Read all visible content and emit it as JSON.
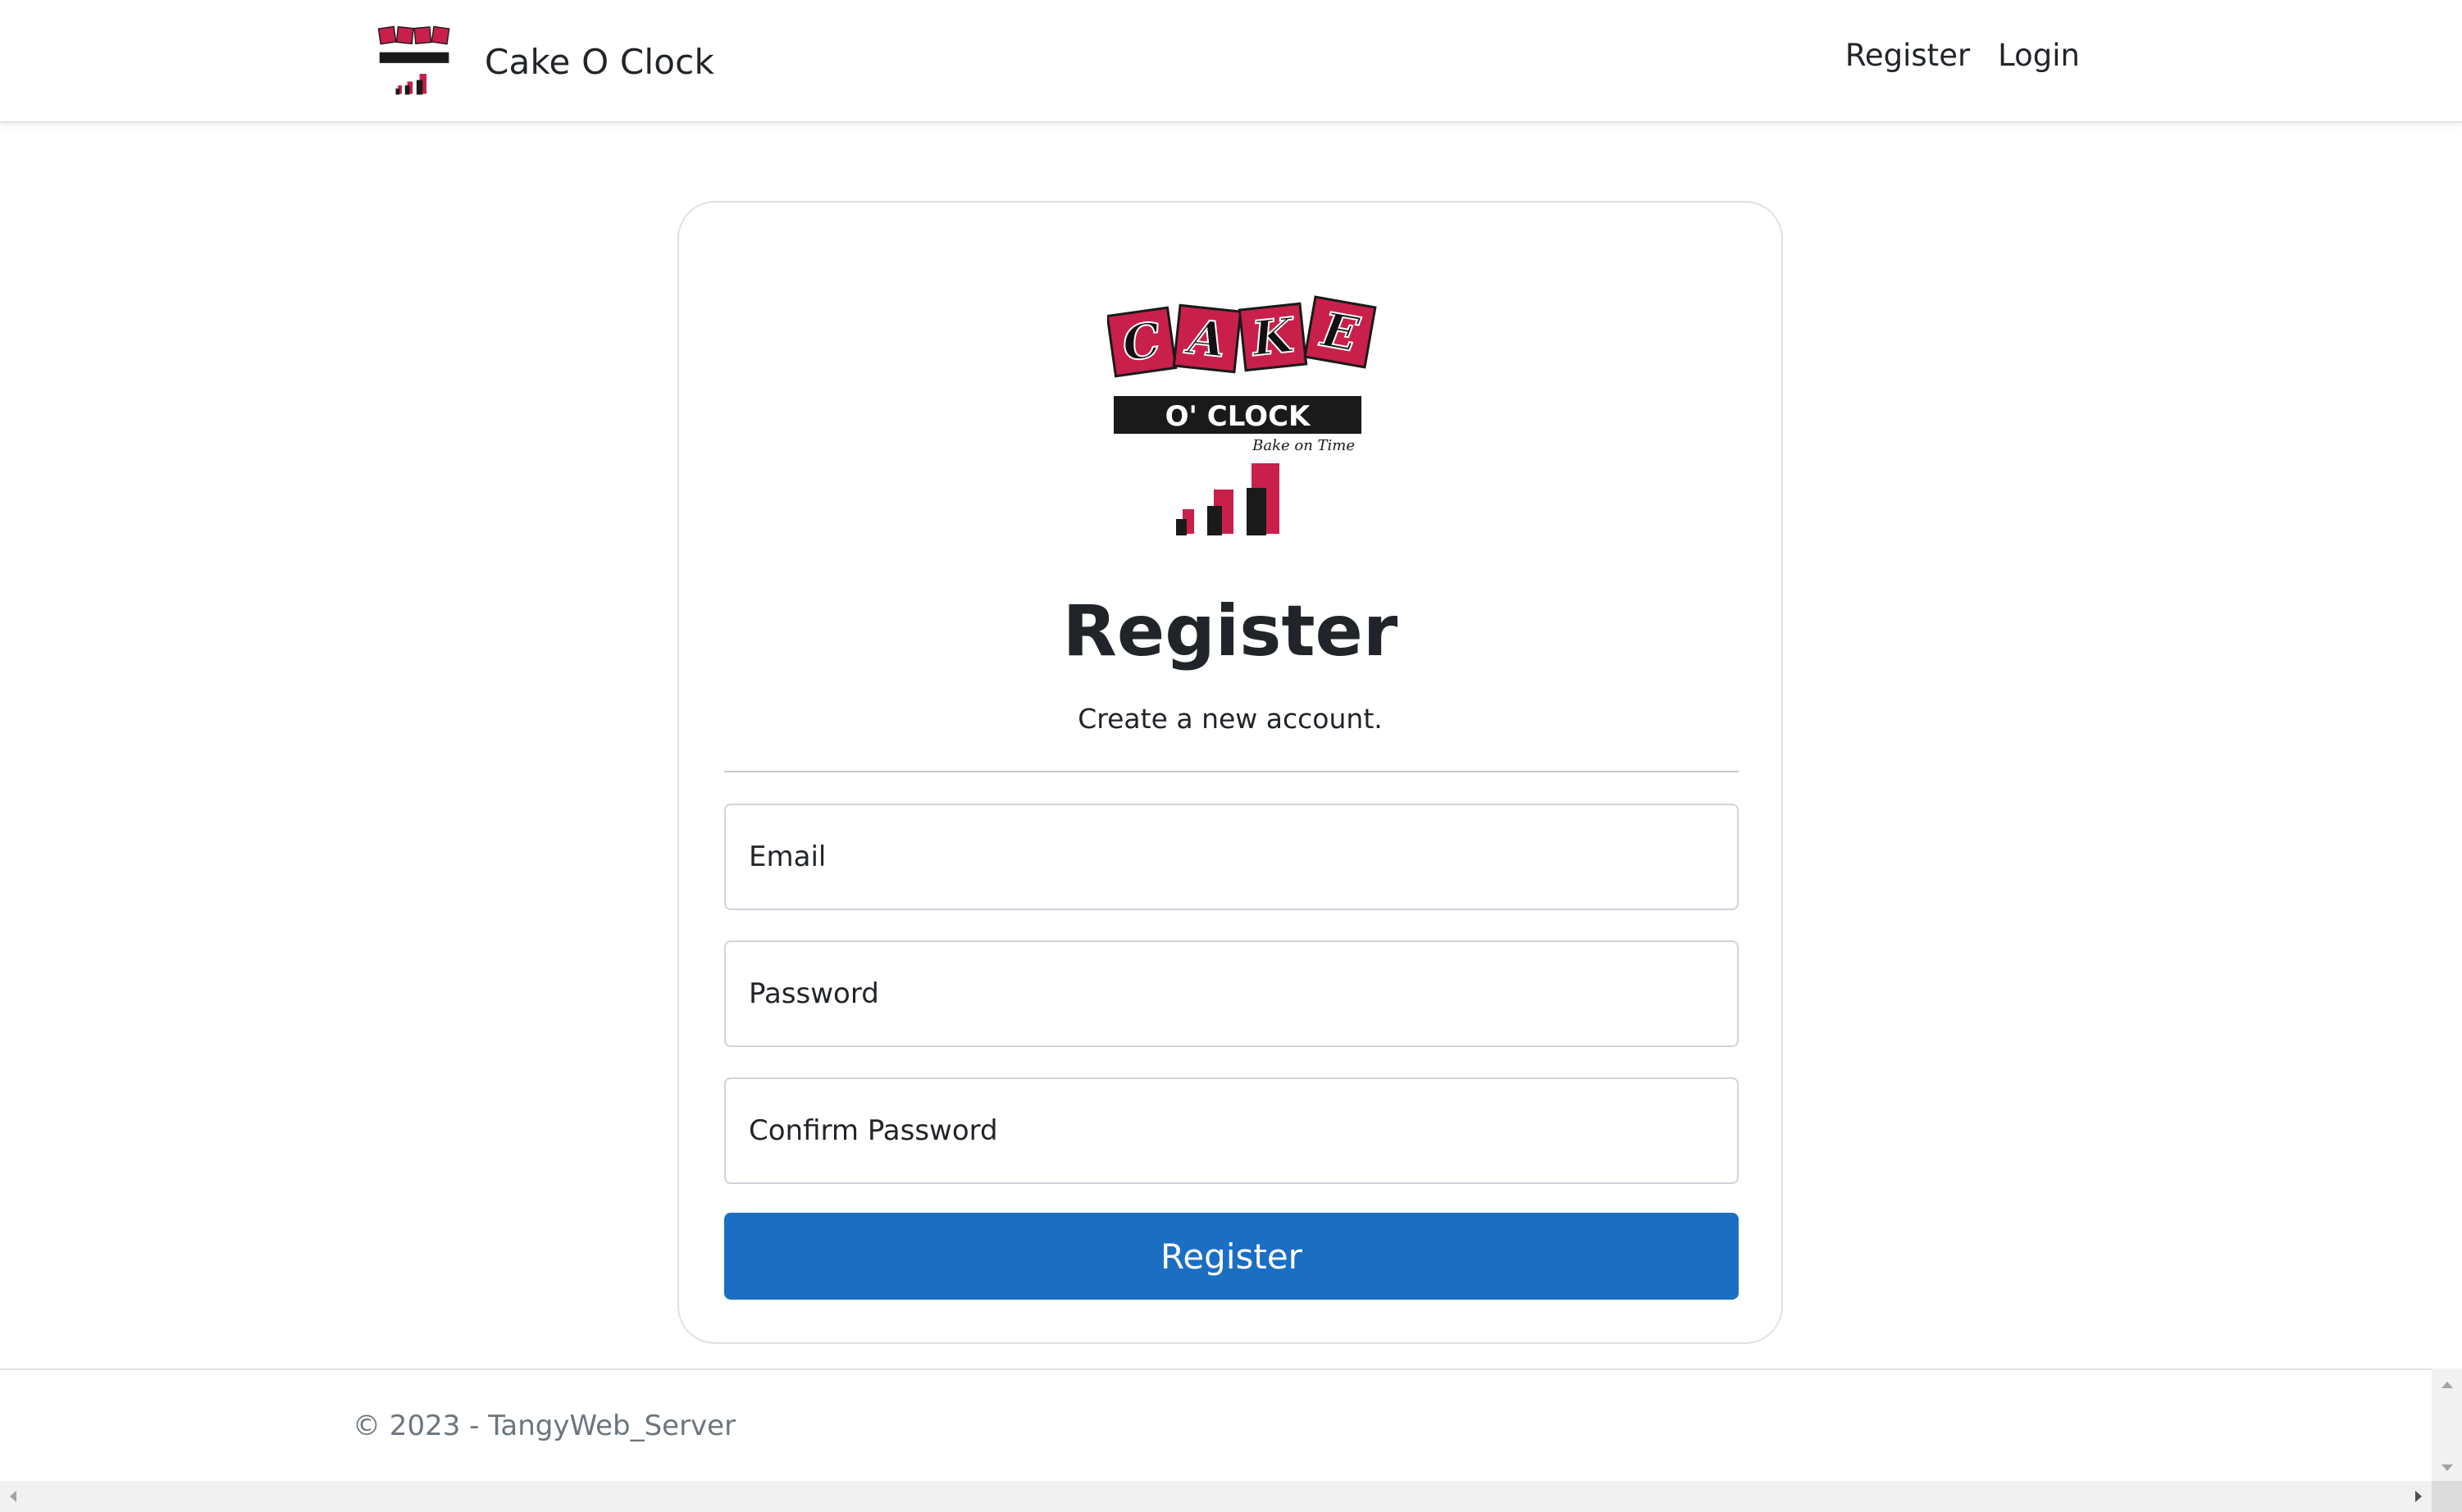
{
  "navbar": {
    "brand_name": "Cake O Clock",
    "links": [
      {
        "label": "Register"
      },
      {
        "label": "Login"
      }
    ]
  },
  "logo": {
    "letters": [
      "C",
      "A",
      "K",
      "E"
    ],
    "banner_text": "O' CLOCK",
    "tagline": "Bake on Time"
  },
  "card": {
    "title": "Register",
    "subtitle": "Create a new account.",
    "email_placeholder": "Email",
    "password_placeholder": "Password",
    "confirm_password_placeholder": "Confirm Password",
    "submit_label": "Register"
  },
  "footer": {
    "copyright": "© 2023 - TangyWeb_Server"
  },
  "colors": {
    "primary": "#1b6ec2",
    "logo_red": "#c8204a",
    "logo_black": "#1a1a1a",
    "muted_text": "#6c757d"
  }
}
